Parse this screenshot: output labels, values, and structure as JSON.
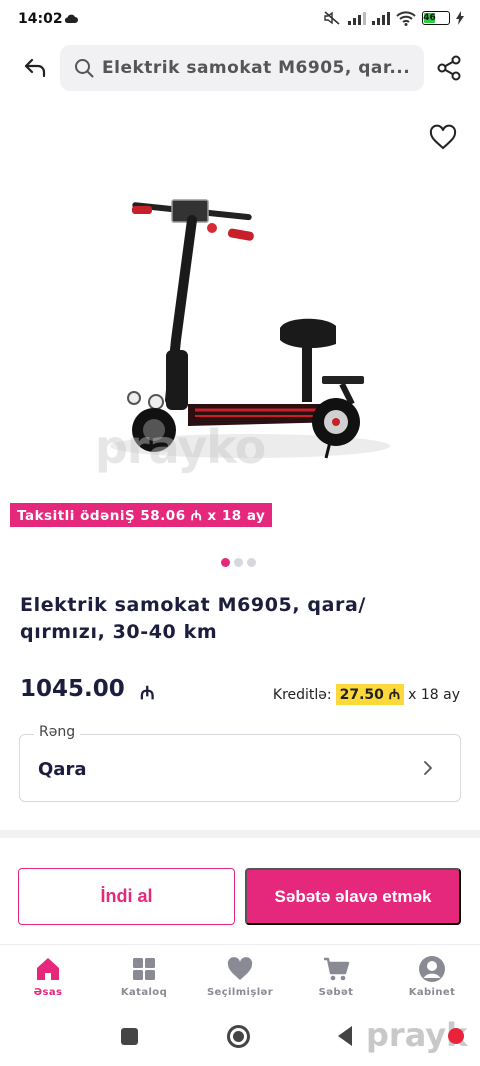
{
  "status_bar": {
    "time": "14:02",
    "battery": "46"
  },
  "search": {
    "query": "Elektrik samokat M6905, qar..."
  },
  "product": {
    "image_watermark": "prayko",
    "installment_badge": "Taksitli ödəniŞ 58.06 ₼ x 18 ay",
    "pager_count": 3,
    "pager_active": 0,
    "title": "Elektrik samokat M6905, qara/ qırmızı, 30-40 km",
    "price": "1045.00",
    "currency": "₼",
    "credit_label": "Kreditlə:",
    "credit_amount": "27.50 ₼",
    "credit_term": "x 18 ay"
  },
  "color_select": {
    "label": "Rəng",
    "value": "Qara"
  },
  "actions": {
    "buy_now": "İndi al",
    "add_to_cart": "Səbətə əlavə etmək"
  },
  "bottom_nav": {
    "items": [
      {
        "label": "Əsas",
        "icon": "home-icon",
        "active": true
      },
      {
        "label": "Kataloq",
        "icon": "grid-icon",
        "active": false
      },
      {
        "label": "Seçilmişlər",
        "icon": "heart-icon",
        "active": false
      },
      {
        "label": "Səbət",
        "icon": "cart-icon",
        "active": false
      },
      {
        "label": "Kabinet",
        "icon": "user-icon",
        "active": false
      }
    ]
  },
  "colors": {
    "accent": "#e6287c",
    "highlight": "#fbd93a",
    "text_dark": "#1d1d3d"
  },
  "watermark": "prayk"
}
